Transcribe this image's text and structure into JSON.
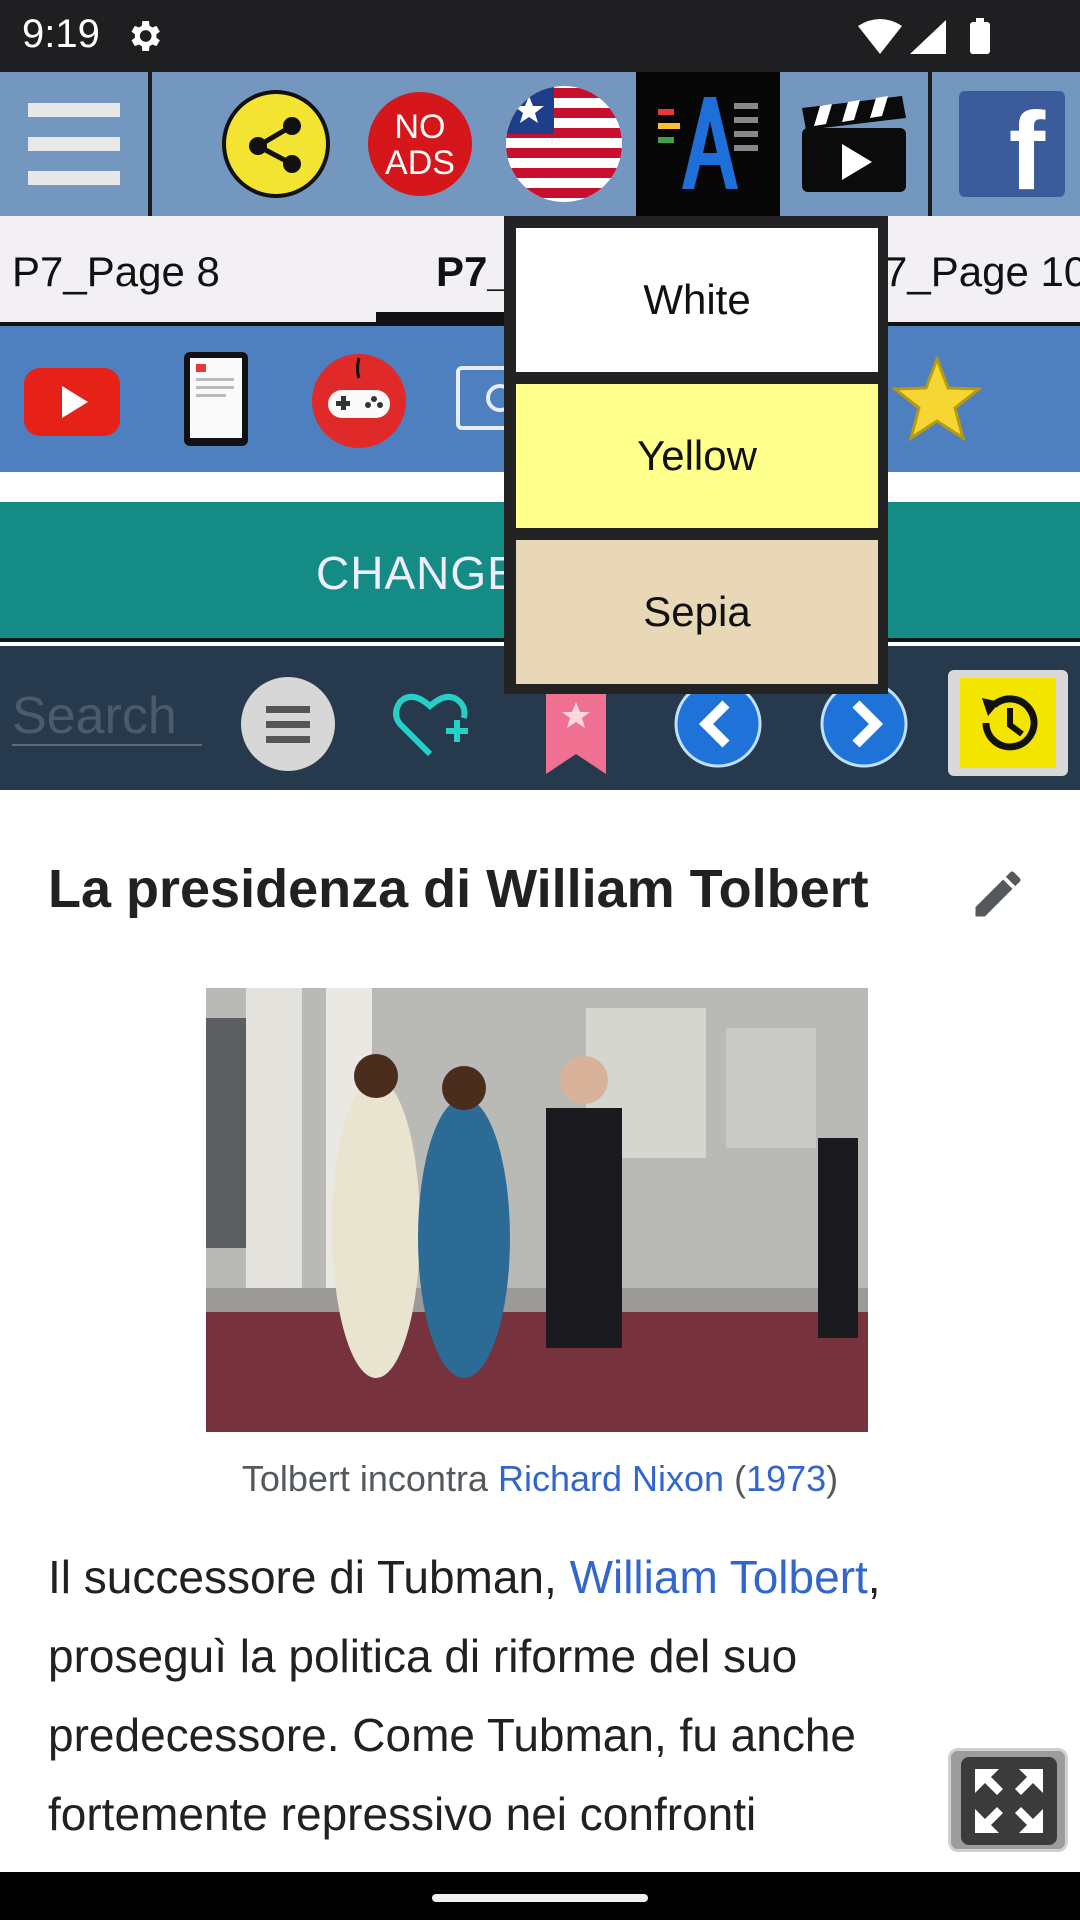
{
  "status_bar": {
    "time": "9:19"
  },
  "toolbar": {
    "no_ads_line1": "NO",
    "no_ads_line2": "ADS",
    "facebook_letter": "f"
  },
  "tabs": {
    "left": "P7_Page 8",
    "active": "P7_",
    "right": "7_Page 10"
  },
  "change_button": {
    "label": "CHANGE"
  },
  "search": {
    "placeholder": "Search"
  },
  "dropdown": {
    "items": [
      {
        "label": "White",
        "color": "#ffffff"
      },
      {
        "label": "Yellow",
        "color": "#ffff8c"
      },
      {
        "label": "Sepia",
        "color": "#e8d8b8"
      }
    ]
  },
  "article": {
    "title": "La presidenza di William Tolbert",
    "caption": {
      "prefix": "Tolbert incontra ",
      "link1": "Richard Nixon",
      "middle": " (",
      "link2": "1973",
      "suffix": ")"
    },
    "paragraph": {
      "prefix": "Il successore di Tubman, ",
      "link": "William Tolbert",
      "rest": ", proseguì la politica di riforme del suo predecessore. Come Tubman, fu anche fortemente repressivo nei confronti"
    }
  },
  "colors": {
    "toolbar_bg": "#7497bf",
    "icon_strip_bg": "#4e7fbf",
    "change_bg": "#158b85",
    "nav_bg": "#273a4d",
    "link": "#3366cc"
  }
}
